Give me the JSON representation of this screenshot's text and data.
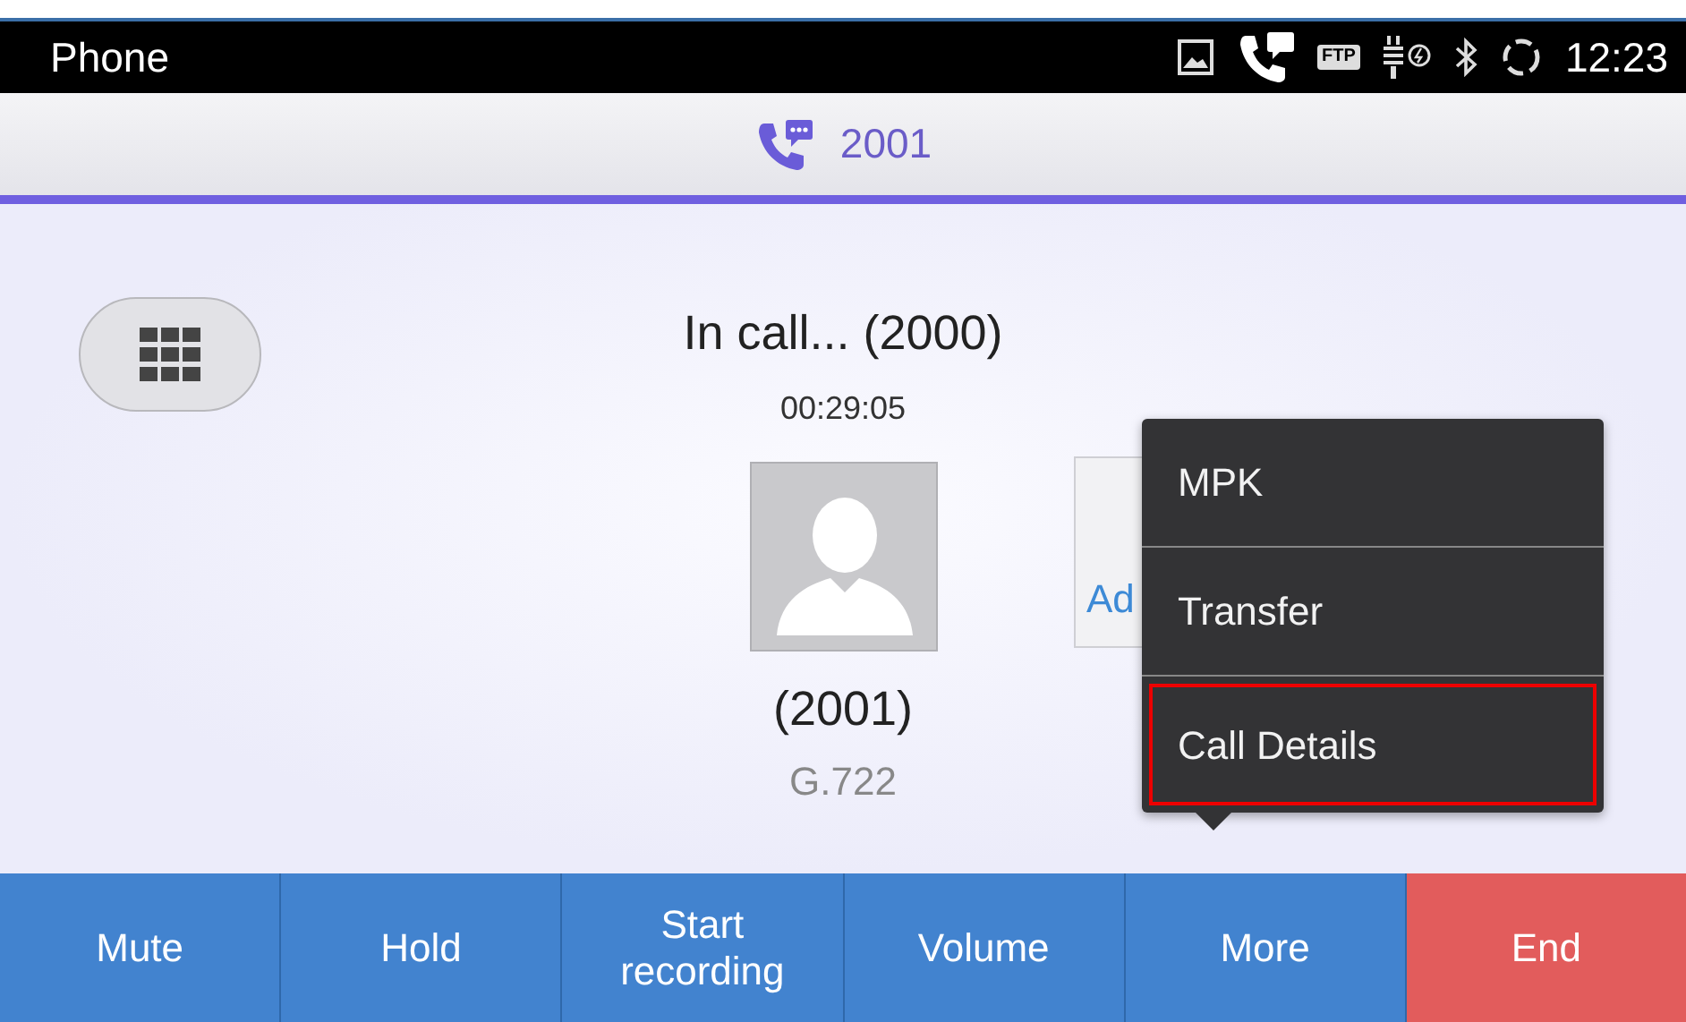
{
  "status_bar": {
    "title": "Phone",
    "ftp_label": "FTP",
    "time": "12:23"
  },
  "call_header": {
    "line": "2001"
  },
  "call": {
    "status": "In call... (2000)",
    "duration": "00:29:05",
    "number": "(2001)",
    "codec": "G.722"
  },
  "contact_card": {
    "label": "Ad"
  },
  "menu": {
    "items": [
      {
        "label": "MPK",
        "highlighted": false
      },
      {
        "label": "Transfer",
        "highlighted": false
      },
      {
        "label": "Call Details",
        "highlighted": true
      }
    ]
  },
  "buttons": [
    {
      "label": "Mute",
      "kind": "normal"
    },
    {
      "label": "Hold",
      "kind": "normal"
    },
    {
      "label": "Start recording",
      "kind": "normal"
    },
    {
      "label": "Volume",
      "kind": "normal"
    },
    {
      "label": "More",
      "kind": "normal"
    },
    {
      "label": "End",
      "kind": "end"
    }
  ]
}
